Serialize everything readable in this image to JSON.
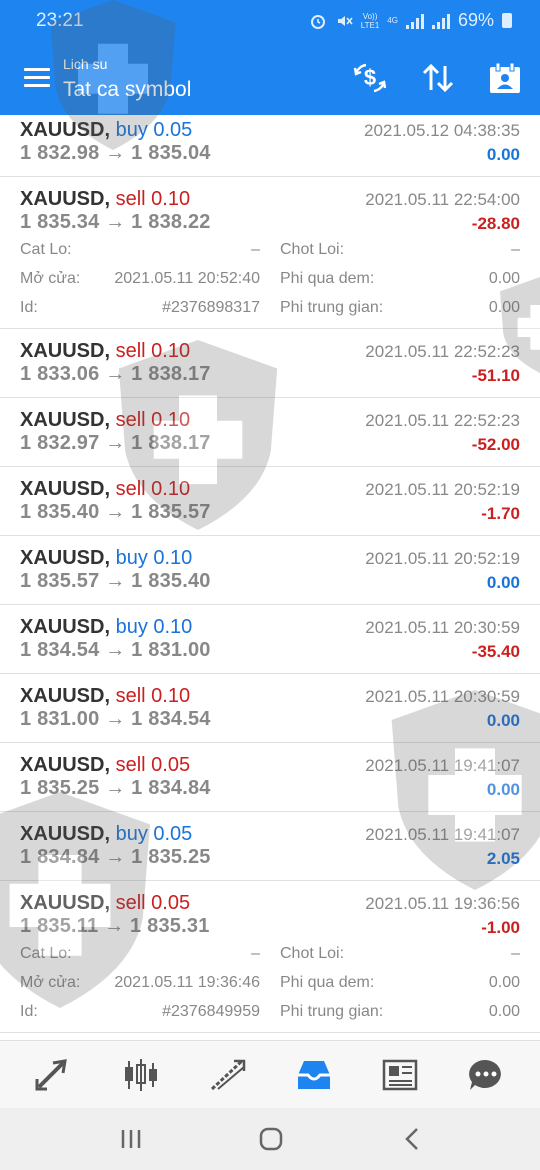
{
  "status": {
    "time": "23:21",
    "network_top": "Vo))",
    "network_bottom": "LTE1",
    "gen": "4G",
    "battery": "69%"
  },
  "header": {
    "subtitle": "Lich su",
    "title": "Tat ca symbol"
  },
  "icons": {
    "menu": "menu-icon",
    "currency": "dollar-exchange-icon",
    "sort": "sort-arrows-icon",
    "calendar": "calendar-person-icon",
    "nav": [
      "quotes-arrows-icon",
      "chart-candles-icon",
      "trade-icon",
      "history-inbox-icon",
      "news-icon",
      "chat-icon"
    ],
    "system": [
      "recent-apps-icon",
      "home-icon",
      "back-icon"
    ]
  },
  "colors": {
    "header": "#1e84ef",
    "sell": "#cc1f1f",
    "buy": "#1a73d9",
    "active_tab": "#1e84ef"
  },
  "labels": {
    "stop_loss": "Cat Lo:",
    "take_profit": "Chot Loi:",
    "open": "Mở cửa:",
    "swap": "Phi qua dem:",
    "id": "Id:",
    "commission": "Phi trung gian:"
  },
  "trades": [
    {
      "symbol": "XAUUSD,",
      "side": "buy 0.05",
      "type": "buy",
      "time": "2021.05.12 04:38:35",
      "prices": "1 832.98 → 1 835.04",
      "profit": "0.00",
      "sign": "pos"
    },
    {
      "symbol": "XAUUSD,",
      "side": "sell 0.10",
      "type": "sell",
      "time": "2021.05.11 22:54:00",
      "prices": "1 835.34 → 1 838.22",
      "profit": "-28.80",
      "sign": "neg",
      "details": {
        "stop_loss": "–",
        "take_profit": "–",
        "open": "2021.05.11 20:52:40",
        "swap": "0.00",
        "id": "#2376898317",
        "commission": "0.00"
      }
    },
    {
      "symbol": "XAUUSD,",
      "side": "sell 0.10",
      "type": "sell",
      "time": "2021.05.11 22:52:23",
      "prices": "1 833.06 → 1 838.17",
      "profit": "-51.10",
      "sign": "neg"
    },
    {
      "symbol": "XAUUSD,",
      "side": "sell 0.10",
      "type": "sell",
      "time": "2021.05.11 22:52:23",
      "prices": "1 832.97 → 1 838.17",
      "profit": "-52.00",
      "sign": "neg"
    },
    {
      "symbol": "XAUUSD,",
      "side": "sell 0.10",
      "type": "sell",
      "time": "2021.05.11 20:52:19",
      "prices": "1 835.40 → 1 835.57",
      "profit": "-1.70",
      "sign": "neg"
    },
    {
      "symbol": "XAUUSD,",
      "side": "buy 0.10",
      "type": "buy",
      "time": "2021.05.11 20:52:19",
      "prices": "1 835.57 → 1 835.40",
      "profit": "0.00",
      "sign": "pos"
    },
    {
      "symbol": "XAUUSD,",
      "side": "buy 0.10",
      "type": "buy",
      "time": "2021.05.11 20:30:59",
      "prices": "1 834.54 → 1 831.00",
      "profit": "-35.40",
      "sign": "neg"
    },
    {
      "symbol": "XAUUSD,",
      "side": "sell 0.10",
      "type": "sell",
      "time": "2021.05.11 20:30:59",
      "prices": "1 831.00 → 1 834.54",
      "profit": "0.00",
      "sign": "pos"
    },
    {
      "symbol": "XAUUSD,",
      "side": "sell 0.05",
      "type": "sell",
      "time": "2021.05.11 19:41:07",
      "prices": "1 835.25 → 1 834.84",
      "profit": "0.00",
      "sign": "pos"
    },
    {
      "symbol": "XAUUSD,",
      "side": "buy 0.05",
      "type": "buy",
      "time": "2021.05.11 19:41:07",
      "prices": "1 834.84 → 1 835.25",
      "profit": "2.05",
      "sign": "pos"
    },
    {
      "symbol": "XAUUSD,",
      "side": "sell 0.05",
      "type": "sell",
      "time": "2021.05.11 19:36:56",
      "prices": "1 835.11 → 1 835.31",
      "profit": "-1.00",
      "sign": "neg",
      "details": {
        "stop_loss": "–",
        "take_profit": "–",
        "open": "2021.05.11 19:36:46",
        "swap": "0.00",
        "id": "#2376849959",
        "commission": "0.00"
      }
    }
  ]
}
